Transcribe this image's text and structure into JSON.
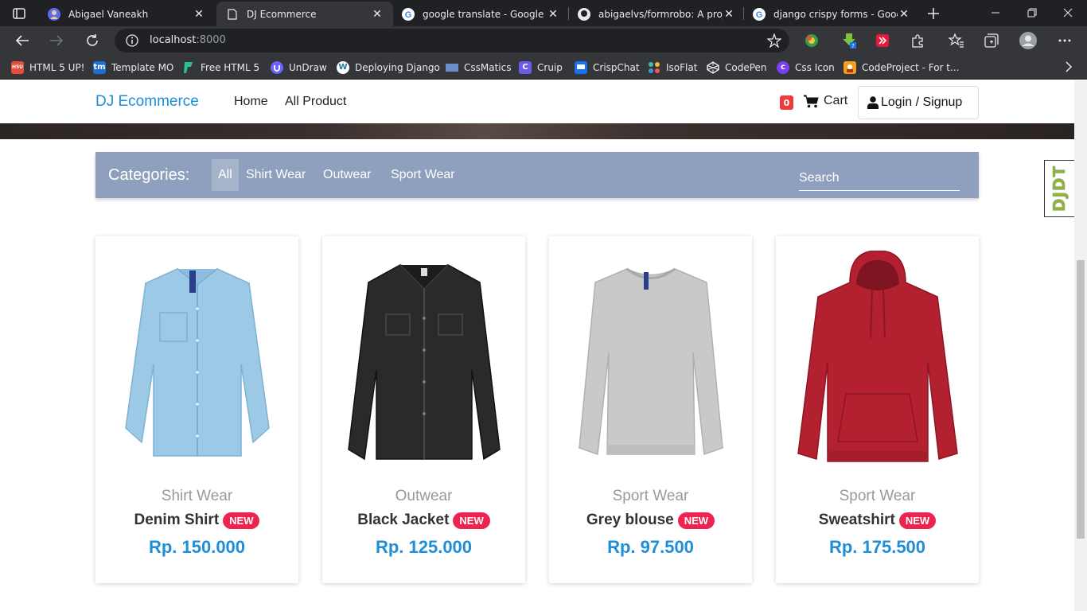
{
  "browser": {
    "tabs": [
      {
        "title": "Abigael Vaneakh",
        "active": false
      },
      {
        "title": "DJ Ecommerce",
        "active": true
      },
      {
        "title": "google translate - Google Sea",
        "active": false
      },
      {
        "title": "abigaelvs/formrobo: A projec",
        "active": false
      },
      {
        "title": "django crispy forms - Google",
        "active": false
      }
    ],
    "url_host": "localhost",
    "url_port": ":8000",
    "bookmarks": [
      {
        "label": "HTML 5 UP!",
        "icon": "html5up-icon",
        "color": "#e44d3a",
        "abbr": "H5U"
      },
      {
        "label": "Template MO",
        "icon": "templatemo-icon",
        "color": "#1c6fd1",
        "abbr": "tm"
      },
      {
        "label": "Free HTML 5",
        "icon": "freehtml5-icon",
        "color": "#2bbf8e",
        "abbr": ""
      },
      {
        "label": "UnDraw",
        "icon": "undraw-icon",
        "color": "#6c63ff",
        "abbr": ""
      },
      {
        "label": "Deploying Django",
        "icon": "wordpress-icon",
        "color": "#ffffff",
        "abbr": "W"
      },
      {
        "label": "CssMatics",
        "icon": "cssmatics-icon",
        "color": "#6d8ec7",
        "abbr": ""
      },
      {
        "label": "Cruip",
        "icon": "cruip-icon",
        "color": "#6b5ce7",
        "abbr": "C"
      },
      {
        "label": "CrispChat",
        "icon": "crispchat-icon",
        "color": "#1972f5",
        "abbr": ""
      },
      {
        "label": "IsoFlat",
        "icon": "isoflat-icon",
        "color": "#3ac3a5",
        "abbr": ""
      },
      {
        "label": "CodePen",
        "icon": "codepen-icon",
        "color": "#ffffff",
        "abbr": ""
      },
      {
        "label": "Css Icon",
        "icon": "cssicon-icon",
        "color": "#7b3ff2",
        "abbr": "c"
      },
      {
        "label": "CodeProject - For t...",
        "icon": "codeproject-icon",
        "color": "#f29e1f",
        "abbr": ""
      }
    ]
  },
  "site": {
    "brand": "DJ Ecommerce",
    "nav": {
      "home": "Home",
      "all_product": "All Product"
    },
    "cart_count": "0",
    "cart_label": "Cart",
    "login_label": "Login / Signup",
    "accent": "#1b8fd6"
  },
  "categories": {
    "title": "Categories:",
    "items": [
      "All",
      "Shirt Wear",
      "Outwear",
      "Sport Wear"
    ],
    "active": "All",
    "search_placeholder": "Search",
    "bar_color": "#8ea0bd"
  },
  "products": [
    {
      "category": "Shirt Wear",
      "name": "Denim Shirt",
      "badge": "NEW",
      "price": "Rp. 150.000",
      "image": "denim-shirt",
      "color": "#9cc9e6"
    },
    {
      "category": "Outwear",
      "name": "Black Jacket",
      "badge": "NEW",
      "price": "Rp. 125.000",
      "image": "black-jacket",
      "color": "#2a2a2a"
    },
    {
      "category": "Sport Wear",
      "name": "Grey blouse",
      "badge": "NEW",
      "price": "Rp. 97.500",
      "image": "grey-sweater",
      "color": "#c9c9c9"
    },
    {
      "category": "Sport Wear",
      "name": "Sweatshirt",
      "badge": "NEW",
      "price": "Rp. 175.500",
      "image": "red-hoodie",
      "color": "#b3202f"
    }
  ],
  "debug_toolbar": {
    "label": "DJDT"
  }
}
